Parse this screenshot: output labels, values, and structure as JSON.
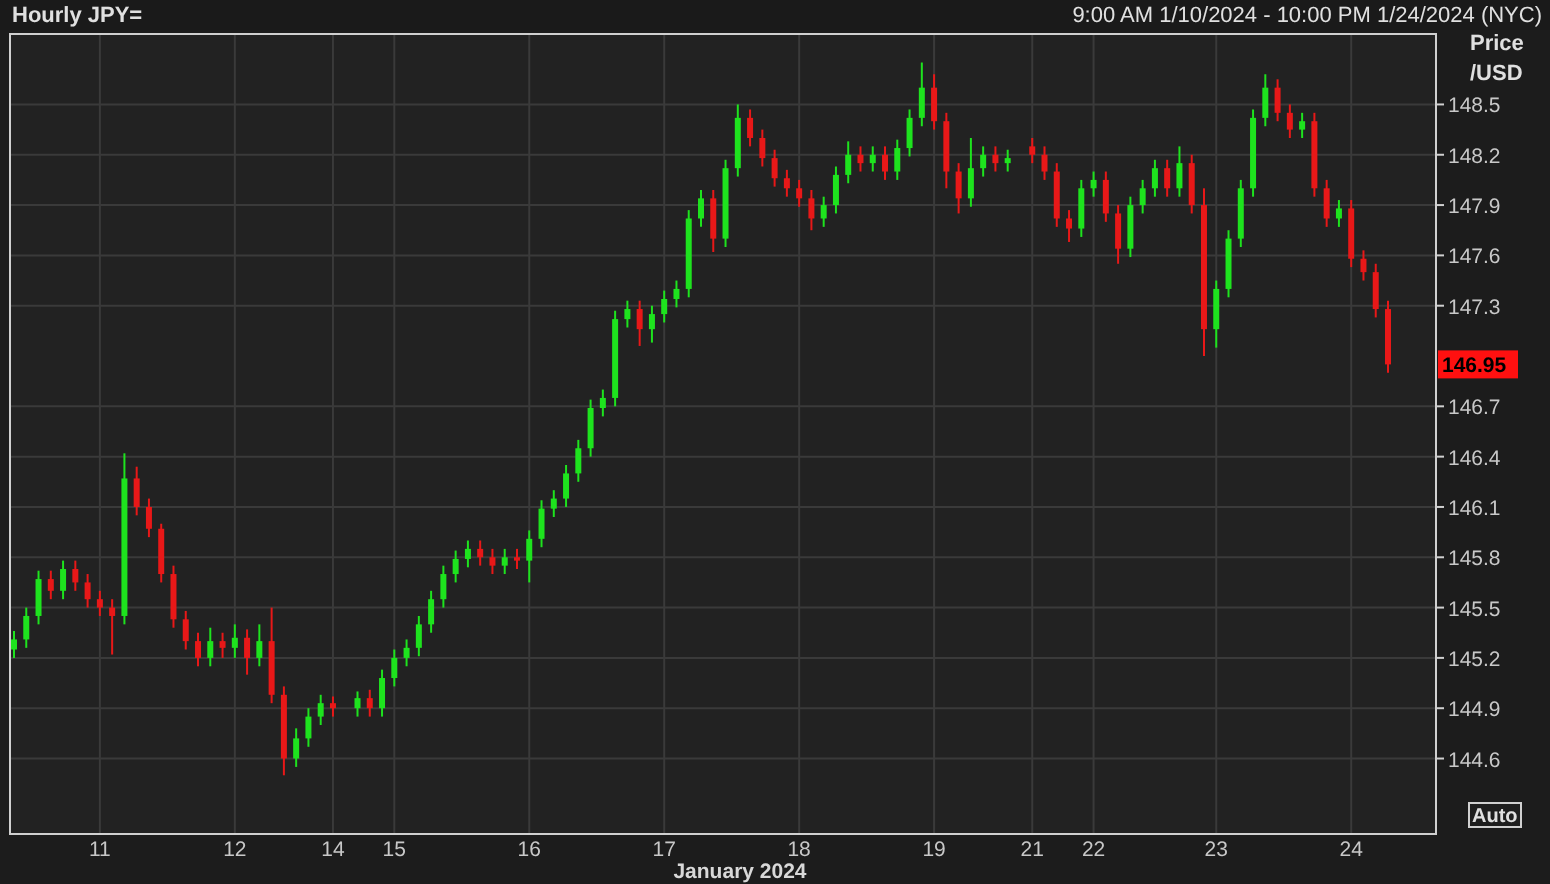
{
  "header": {
    "title": "Hourly JPY=",
    "range": "9:00 AM 1/10/2024 - 10:00 PM 1/24/2024 (NYC)"
  },
  "chart": {
    "axis_title": [
      "Price",
      "/USD"
    ],
    "last_price_label": "146.95",
    "auto_button": "Auto",
    "chart_data": {
      "type": "candlestick",
      "xlabel": "January 2024",
      "ylim": [
        144.15,
        148.92
      ],
      "grid": true,
      "yticks": [
        148.5,
        148.2,
        147.9,
        147.6,
        147.3,
        146.7,
        146.4,
        146.1,
        145.8,
        145.5,
        145.2,
        144.9,
        144.6
      ],
      "categories": [
        null,
        null,
        null,
        null,
        null,
        null,
        null,
        "11",
        null,
        null,
        null,
        null,
        null,
        null,
        null,
        null,
        null,
        null,
        "12",
        null,
        null,
        null,
        null,
        null,
        null,
        null,
        "14",
        null,
        null,
        null,
        null,
        "15",
        null,
        null,
        null,
        null,
        null,
        null,
        null,
        null,
        null,
        null,
        "16",
        null,
        null,
        null,
        null,
        null,
        null,
        null,
        null,
        null,
        null,
        "17",
        null,
        null,
        null,
        null,
        null,
        null,
        null,
        null,
        null,
        null,
        "18",
        null,
        null,
        null,
        null,
        null,
        null,
        null,
        null,
        null,
        null,
        "19",
        null,
        null,
        null,
        null,
        null,
        null,
        null,
        "21",
        null,
        null,
        null,
        null,
        "22",
        null,
        null,
        null,
        null,
        null,
        null,
        null,
        null,
        null,
        "23",
        null,
        null,
        null,
        null,
        null,
        null,
        null,
        null,
        null,
        null,
        "24",
        null,
        null,
        null
      ],
      "ohlc": [
        [
          145.25,
          145.36,
          145.2,
          145.31
        ],
        [
          145.31,
          145.5,
          145.26,
          145.45
        ],
        [
          145.45,
          145.72,
          145.4,
          145.67
        ],
        [
          145.67,
          145.72,
          145.55,
          145.6
        ],
        [
          145.6,
          145.78,
          145.55,
          145.73
        ],
        [
          145.73,
          145.78,
          145.6,
          145.65
        ],
        [
          145.65,
          145.7,
          145.5,
          145.55
        ],
        [
          145.55,
          145.6,
          145.45,
          145.5
        ],
        [
          145.5,
          145.55,
          145.22,
          145.45
        ],
        [
          145.45,
          146.42,
          145.4,
          146.27
        ],
        [
          146.27,
          146.34,
          146.05,
          146.1
        ],
        [
          146.1,
          146.15,
          145.92,
          145.97
        ],
        [
          145.97,
          146.0,
          145.65,
          145.7
        ],
        [
          145.7,
          145.75,
          145.38,
          145.43
        ],
        [
          145.43,
          145.48,
          145.25,
          145.3
        ],
        [
          145.3,
          145.35,
          145.15,
          145.2
        ],
        [
          145.2,
          145.38,
          145.15,
          145.3
        ],
        [
          145.3,
          145.35,
          145.2,
          145.26
        ],
        [
          145.26,
          145.4,
          145.2,
          145.32
        ],
        [
          145.32,
          145.37,
          145.1,
          145.2
        ],
        [
          145.2,
          145.4,
          145.15,
          145.3
        ],
        [
          145.3,
          145.5,
          144.93,
          144.98
        ],
        [
          144.98,
          145.03,
          144.5,
          144.6
        ],
        [
          144.6,
          144.78,
          144.55,
          144.72
        ],
        [
          144.72,
          144.9,
          144.67,
          144.85
        ],
        [
          144.85,
          144.98,
          144.8,
          144.93
        ],
        [
          144.93,
          144.97,
          144.85,
          144.9
        ],
        null,
        [
          144.9,
          145.0,
          144.85,
          144.96
        ],
        [
          144.96,
          145.01,
          144.85,
          144.9
        ],
        [
          144.9,
          145.13,
          144.85,
          145.08
        ],
        [
          145.08,
          145.25,
          145.03,
          145.2
        ],
        [
          145.2,
          145.31,
          145.15,
          145.26
        ],
        [
          145.26,
          145.45,
          145.21,
          145.4
        ],
        [
          145.4,
          145.6,
          145.35,
          145.55
        ],
        [
          145.55,
          145.75,
          145.5,
          145.7
        ],
        [
          145.7,
          145.84,
          145.65,
          145.79
        ],
        [
          145.79,
          145.9,
          145.74,
          145.85
        ],
        [
          145.85,
          145.9,
          145.75,
          145.8
        ],
        [
          145.8,
          145.85,
          145.7,
          145.75
        ],
        [
          145.75,
          145.85,
          145.7,
          145.8
        ],
        [
          145.8,
          145.85,
          145.73,
          145.78
        ],
        [
          145.78,
          145.96,
          145.65,
          145.91
        ],
        [
          145.91,
          146.14,
          145.86,
          146.09
        ],
        [
          146.09,
          146.2,
          146.04,
          146.15
        ],
        [
          146.15,
          146.35,
          146.1,
          146.3
        ],
        [
          146.3,
          146.5,
          146.25,
          146.45
        ],
        [
          146.45,
          146.74,
          146.4,
          146.69
        ],
        [
          146.69,
          146.8,
          146.64,
          146.75
        ],
        [
          146.75,
          147.27,
          146.7,
          147.22
        ],
        [
          147.22,
          147.33,
          147.17,
          147.28
        ],
        [
          147.28,
          147.33,
          147.06,
          147.16
        ],
        [
          147.16,
          147.3,
          147.08,
          147.25
        ],
        [
          147.25,
          147.39,
          147.2,
          147.34
        ],
        [
          147.34,
          147.45,
          147.29,
          147.4
        ],
        [
          147.4,
          147.87,
          147.35,
          147.82
        ],
        [
          147.82,
          147.99,
          147.77,
          147.94
        ],
        [
          147.94,
          147.99,
          147.62,
          147.7
        ],
        [
          147.7,
          148.17,
          147.65,
          148.12
        ],
        [
          148.12,
          148.5,
          148.07,
          148.42
        ],
        [
          148.42,
          148.47,
          148.25,
          148.3
        ],
        [
          148.3,
          148.35,
          148.13,
          148.18
        ],
        [
          148.18,
          148.23,
          148.01,
          148.06
        ],
        [
          148.06,
          148.11,
          147.95,
          148.0
        ],
        [
          148.0,
          148.05,
          147.89,
          147.94
        ],
        [
          147.94,
          147.99,
          147.75,
          147.82
        ],
        [
          147.82,
          147.95,
          147.77,
          147.9
        ],
        [
          147.9,
          148.13,
          147.85,
          148.08
        ],
        [
          148.08,
          148.28,
          148.03,
          148.2
        ],
        [
          148.2,
          148.25,
          148.1,
          148.15
        ],
        [
          148.15,
          148.25,
          148.1,
          148.2
        ],
        [
          148.2,
          148.25,
          148.05,
          148.1
        ],
        [
          148.1,
          148.29,
          148.05,
          148.24
        ],
        [
          148.24,
          148.47,
          148.19,
          148.42
        ],
        [
          148.42,
          148.75,
          148.37,
          148.6
        ],
        [
          148.6,
          148.68,
          148.35,
          148.4
        ],
        [
          148.4,
          148.45,
          148.0,
          148.1
        ],
        [
          148.1,
          148.15,
          147.85,
          147.94
        ],
        [
          147.94,
          148.3,
          147.89,
          148.12
        ],
        [
          148.12,
          148.25,
          148.07,
          148.2
        ],
        [
          148.2,
          148.25,
          148.1,
          148.15
        ],
        [
          148.15,
          148.23,
          148.1,
          148.18
        ],
        null,
        [
          148.25,
          148.3,
          148.15,
          148.2
        ],
        [
          148.2,
          148.25,
          148.05,
          148.1
        ],
        [
          148.1,
          148.15,
          147.77,
          147.82
        ],
        [
          147.82,
          147.87,
          147.68,
          147.76
        ],
        [
          147.76,
          148.05,
          147.71,
          148.0
        ],
        [
          148.0,
          148.1,
          147.95,
          148.05
        ],
        [
          148.05,
          148.1,
          147.8,
          147.85
        ],
        [
          147.85,
          147.9,
          147.55,
          147.64
        ],
        [
          147.64,
          147.95,
          147.59,
          147.9
        ],
        [
          147.9,
          148.05,
          147.85,
          148.0
        ],
        [
          148.0,
          148.17,
          147.95,
          148.12
        ],
        [
          148.12,
          148.17,
          147.95,
          148.0
        ],
        [
          148.0,
          148.25,
          147.95,
          148.15
        ],
        [
          148.15,
          148.2,
          147.85,
          147.9
        ],
        [
          147.9,
          148.0,
          147.0,
          147.16
        ],
        [
          147.16,
          147.45,
          147.05,
          147.4
        ],
        [
          147.4,
          147.75,
          147.35,
          147.7
        ],
        [
          147.7,
          148.05,
          147.65,
          148.0
        ],
        [
          148.0,
          148.47,
          147.95,
          148.42
        ],
        [
          148.42,
          148.68,
          148.37,
          148.6
        ],
        [
          148.6,
          148.65,
          148.4,
          148.45
        ],
        [
          148.45,
          148.5,
          148.3,
          148.35
        ],
        [
          148.35,
          148.45,
          148.3,
          148.4
        ],
        [
          148.4,
          148.45,
          147.95,
          148.0
        ],
        [
          148.0,
          148.05,
          147.77,
          147.82
        ],
        [
          147.82,
          147.93,
          147.77,
          147.88
        ],
        [
          147.88,
          147.93,
          147.53,
          147.58
        ],
        [
          147.58,
          147.63,
          147.45,
          147.5
        ],
        [
          147.5,
          147.55,
          147.23,
          147.28
        ],
        [
          147.28,
          147.33,
          146.9,
          146.95
        ]
      ]
    }
  }
}
